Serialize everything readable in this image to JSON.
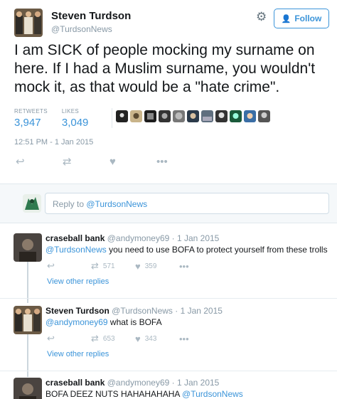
{
  "tweet": {
    "author_name": "Steven Turdson",
    "author_handle": "@TurdsonNews",
    "follow_label": "Follow",
    "text": "I am SICK of people mocking my surname on here. If I had a Muslim surname, you wouldn't mock it, as that would be a \"hate crime\".",
    "retweets_label": "RETWEETS",
    "retweets": "3,947",
    "likes_label": "LIKES",
    "likes": "3,049",
    "timestamp": "12:51 PM - 1 Jan 2015"
  },
  "reply_box": {
    "placeholder_prefix": "Reply to ",
    "placeholder_handle": "@TurdsonNews"
  },
  "replies": [
    {
      "name": "craseball bank",
      "meta": "@andymoney69 · 1 Jan 2015",
      "mention": "@TurdsonNews",
      "text": " you need to use BOFA to protect yourself from these trolls",
      "retweets": "571",
      "likes": "359",
      "view_more": "View other replies"
    },
    {
      "name": "Steven Turdson",
      "meta": "@TurdsonNews · 1 Jan 2015",
      "mention": "@andymoney69",
      "text": " what is BOFA",
      "retweets": "653",
      "likes": "343",
      "view_more": "View other replies"
    },
    {
      "name": "craseball bank",
      "meta": "@andymoney69 · 1 Jan 2015",
      "text": "BOFA DEEZ NUTS HAHAHAHAHA ",
      "mention": "@TurdsonNews"
    }
  ],
  "icons": {
    "settings": "gear-icon",
    "follow": "add-user-icon",
    "reply": "reply-arrow-icon",
    "retweet": "retweet-icon",
    "like": "heart-icon",
    "more": "more-dots-icon"
  },
  "colors": {
    "link": "#3b94d9",
    "muted": "#8899a6",
    "text": "#14171a",
    "reply_bg": "#f5f8fa"
  }
}
